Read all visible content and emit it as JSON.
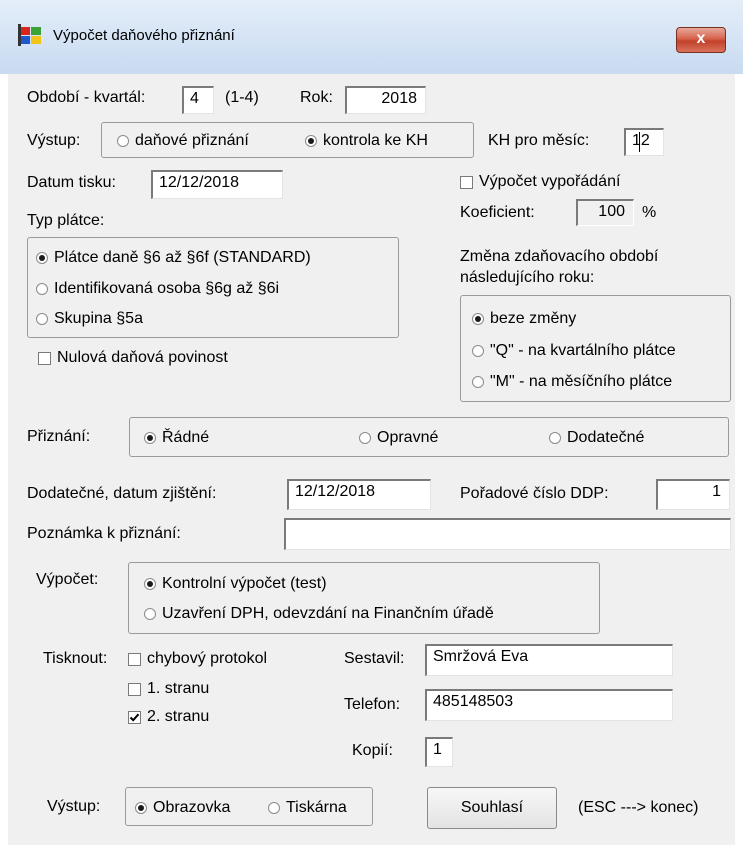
{
  "window": {
    "title": "Výpočet daňového přiznání",
    "close_label": "x"
  },
  "period": {
    "label": "Období - kvartál:",
    "quarter": "4",
    "range_hint": "(1-4)",
    "year_label": "Rok:",
    "year": "2018"
  },
  "output_type": {
    "label": "Výstup:",
    "options": [
      "daňové přiznání",
      "kontrola ke KH"
    ],
    "selected_index": 1
  },
  "kh_month": {
    "label": "KH pro měsíc:",
    "value": "12"
  },
  "print_date": {
    "label": "Datum tisku:",
    "value": "12/12/2018"
  },
  "settlement": {
    "label": "Výpočet vypořádání",
    "checked": false,
    "coef_label": "Koeficient:",
    "coef_value": "100",
    "coef_unit": "%"
  },
  "payer_type": {
    "label": "Typ plátce:",
    "options": [
      "Plátce daně §6 až §6f  (STANDARD)",
      "Identifikovaná osoba §6g až §6i",
      "Skupina §5a"
    ],
    "selected_index": 0
  },
  "zero_duty": {
    "label": "Nulová daňová povinost",
    "checked": false
  },
  "period_change": {
    "label_line1": "Změna zdaňovacího období",
    "label_line2": "následujícího roku:",
    "options": [
      "beze změny",
      "\"Q\" - na kvartálního plátce",
      "\"M\" - na měsíčního plátce"
    ],
    "selected_index": 0
  },
  "filing": {
    "label": "Přiznání:",
    "options": [
      "Řádné",
      "Opravné",
      "Dodatečné"
    ],
    "selected_index": 0
  },
  "supplementary": {
    "date_label": "Dodatečné, datum zjištění:",
    "date_value": "12/12/2018",
    "ddp_label": "Pořadové číslo DDP:",
    "ddp_value": "1"
  },
  "note": {
    "label": "Poznámka k přiznání:",
    "value": ""
  },
  "calculation": {
    "label": "Výpočet:",
    "options": [
      "Kontrolní výpočet (test)",
      "Uzavření DPH, odevzdání na Finančním úřadě"
    ],
    "selected_index": 0
  },
  "print": {
    "label": "Tisknout:",
    "options": [
      {
        "label": "chybový protokol",
        "checked": false
      },
      {
        "label": "1. stranu",
        "checked": false
      },
      {
        "label": "2. stranu",
        "checked": true
      }
    ]
  },
  "compiled_by": {
    "label": "Sestavil:",
    "value": "Smržová Eva"
  },
  "phone": {
    "label": "Telefon:",
    "value": "485148503"
  },
  "copies": {
    "label": "Kopií:",
    "value": "1"
  },
  "output_device": {
    "label": "Výstup:",
    "options": [
      "Obrazovka",
      "Tiskárna"
    ],
    "selected_index": 0
  },
  "actions": {
    "agree_label": "Souhlasí",
    "hint": "(ESC ---> konec)"
  },
  "colors": {
    "dialog_bg": "#f0f0f0",
    "title_bg": "#d3e2f4",
    "close_red": "#c94a32"
  }
}
